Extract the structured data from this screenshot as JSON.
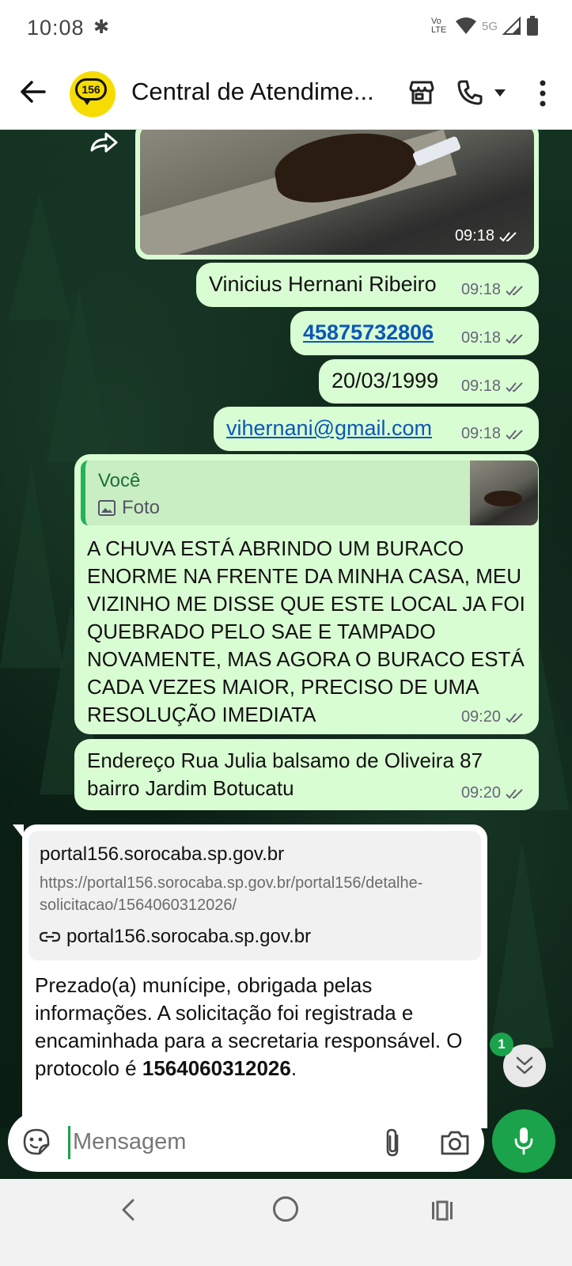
{
  "status_bar": {
    "time": "10:08",
    "network": "5G",
    "lte": "Vo LTE"
  },
  "header": {
    "title": "Central de Atendime...",
    "avatar_text": "156"
  },
  "messages": {
    "photo_time": "09:18",
    "name": {
      "text": "Vinicius Hernani Ribeiro",
      "time": "09:18"
    },
    "cpf": {
      "text": "45875732806",
      "time": "09:18"
    },
    "birth": {
      "text": "20/03/1999",
      "time": "09:18"
    },
    "email": {
      "text": "vihernani@gmail.com",
      "time": "09:18"
    },
    "complaint": {
      "quote_author": "Você",
      "quote_type": "Foto",
      "text": "A CHUVA ESTÁ ABRINDO UM BURACO ENORME NA FRENTE DA MINHA CASA, MEU VIZINHO ME DISSE QUE ESTE LOCAL JA FOI QUEBRADO PELO SAE E TAMPADO NOVAMENTE, MAS AGORA O BURACO ESTÁ CADA VEZES MAIOR, PRECISO DE UMA RESOLUÇÃO IMEDIATA",
      "time": "09:20"
    },
    "address": {
      "text": "Endereço Rua Julia balsamo de Oliveira 87 bairro Jardim Botucatu",
      "time": "09:20"
    },
    "reply": {
      "preview_domain": "portal156.sorocaba.sp.gov.br",
      "preview_url": "https://portal156.sorocaba.sp.gov.br/portal156/detalhe-solicitacao/1564060312026/",
      "preview_footer": "portal156.sorocaba.sp.gov.br",
      "text_before": "Prezado(a) munícipe, obrigada pelas informações. A solicitação foi registrada e encaminhada para a secretaria responsável. O protocolo é ",
      "protocol": "1564060312026",
      "text_after": "."
    }
  },
  "unread_count": "1",
  "composer": {
    "placeholder": "Mensagem"
  },
  "colors": {
    "accent": "#1aa34a",
    "outgoing_bubble": "#d9fdd3",
    "link": "#0b57b8"
  }
}
